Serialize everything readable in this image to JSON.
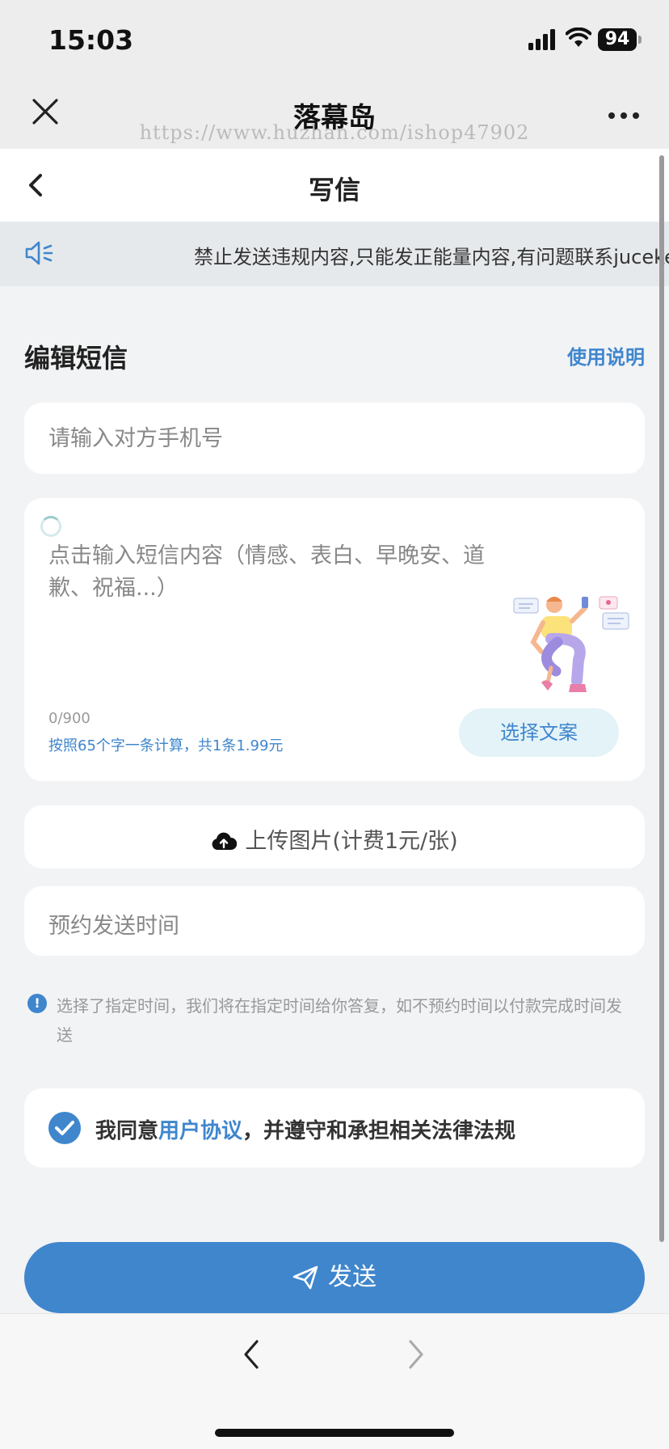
{
  "status": {
    "time": "15:03",
    "battery": "94"
  },
  "wx": {
    "title": "落幕岛",
    "watermark": "https://www.huzhan.com/ishop47902"
  },
  "page": {
    "title": "写信"
  },
  "notice": {
    "text": "禁止发送违规内容,只能发正能量内容,有问题联系juceke"
  },
  "section": {
    "title": "编辑短信",
    "help": "使用说明"
  },
  "form": {
    "phone_placeholder": "请输入对方手机号",
    "content_placeholder": "点击输入短信内容（情感、表白、早晚安、道歉、祝福...）",
    "char_count": "0/900",
    "price_note": "按照65个字一条计算，共1条1.99元",
    "choose_label": "选择文案",
    "upload_label": "上传图片(计费1元/张)",
    "schedule_label": "预约发送时间",
    "info_text": "选择了指定时间，我们将在指定时间给你答复，如不预约时间以付款完成时间发送"
  },
  "agree": {
    "prefix": "我同意",
    "link": "用户协议",
    "suffix": "，并遵守和承担相关法律法规"
  },
  "send": {
    "label": "发送"
  },
  "colors": {
    "accent": "#3f86cd",
    "background": "#f2f3f5"
  },
  "icons": [
    "close-icon",
    "more-icon",
    "back-icon",
    "speaker-icon",
    "upload-cloud-icon",
    "info-icon",
    "check-icon",
    "send-plane-icon",
    "nav-back-icon",
    "nav-forward-icon"
  ]
}
